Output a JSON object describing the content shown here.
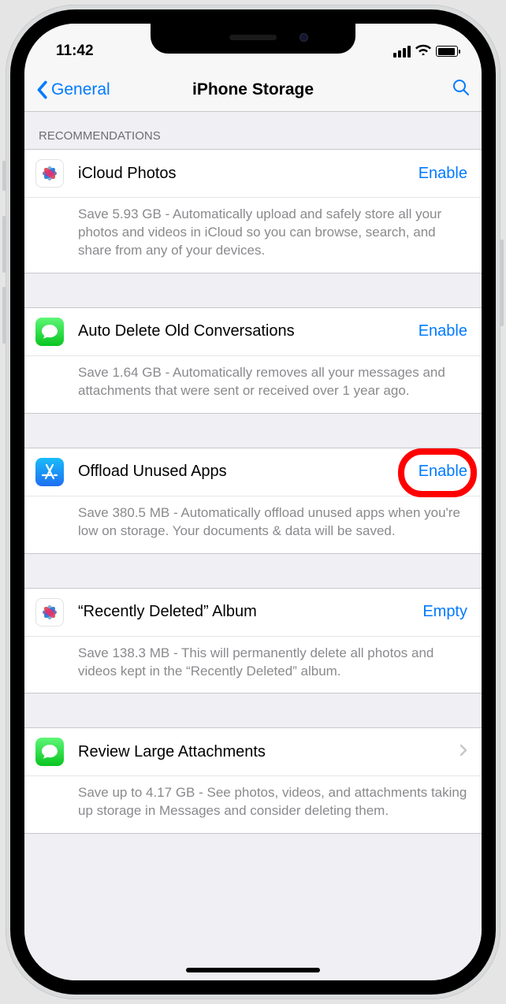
{
  "status": {
    "time": "11:42"
  },
  "nav": {
    "back": "General",
    "title": "iPhone Storage"
  },
  "section_header": "RECOMMENDATIONS",
  "items": [
    {
      "icon": "photos",
      "title": "iCloud Photos",
      "action": "Enable",
      "desc": "Save 5.93 GB - Automatically upload and safely store all your photos and videos in iCloud so you can browse, search, and share from any of your devices."
    },
    {
      "icon": "messages",
      "title": "Auto Delete Old Conversations",
      "action": "Enable",
      "desc": "Save 1.64 GB - Automatically removes all your messages and attachments that were sent or received over 1 year ago."
    },
    {
      "icon": "appstore",
      "title": "Offload Unused Apps",
      "action": "Enable",
      "highlighted": true,
      "desc": "Save 380.5 MB - Automatically offload unused apps when you're low on storage. Your documents & data will be saved."
    },
    {
      "icon": "photos",
      "title": "“Recently Deleted” Album",
      "action": "Empty",
      "desc": "Save 138.3 MB - This will permanently delete all photos and videos kept in the “Recently Deleted” album."
    },
    {
      "icon": "messages",
      "title": "Review Large Attachments",
      "action": "chevron",
      "desc": "Save up to 4.17 GB - See photos, videos, and attachments taking up storage in Messages and consider deleting them."
    }
  ]
}
